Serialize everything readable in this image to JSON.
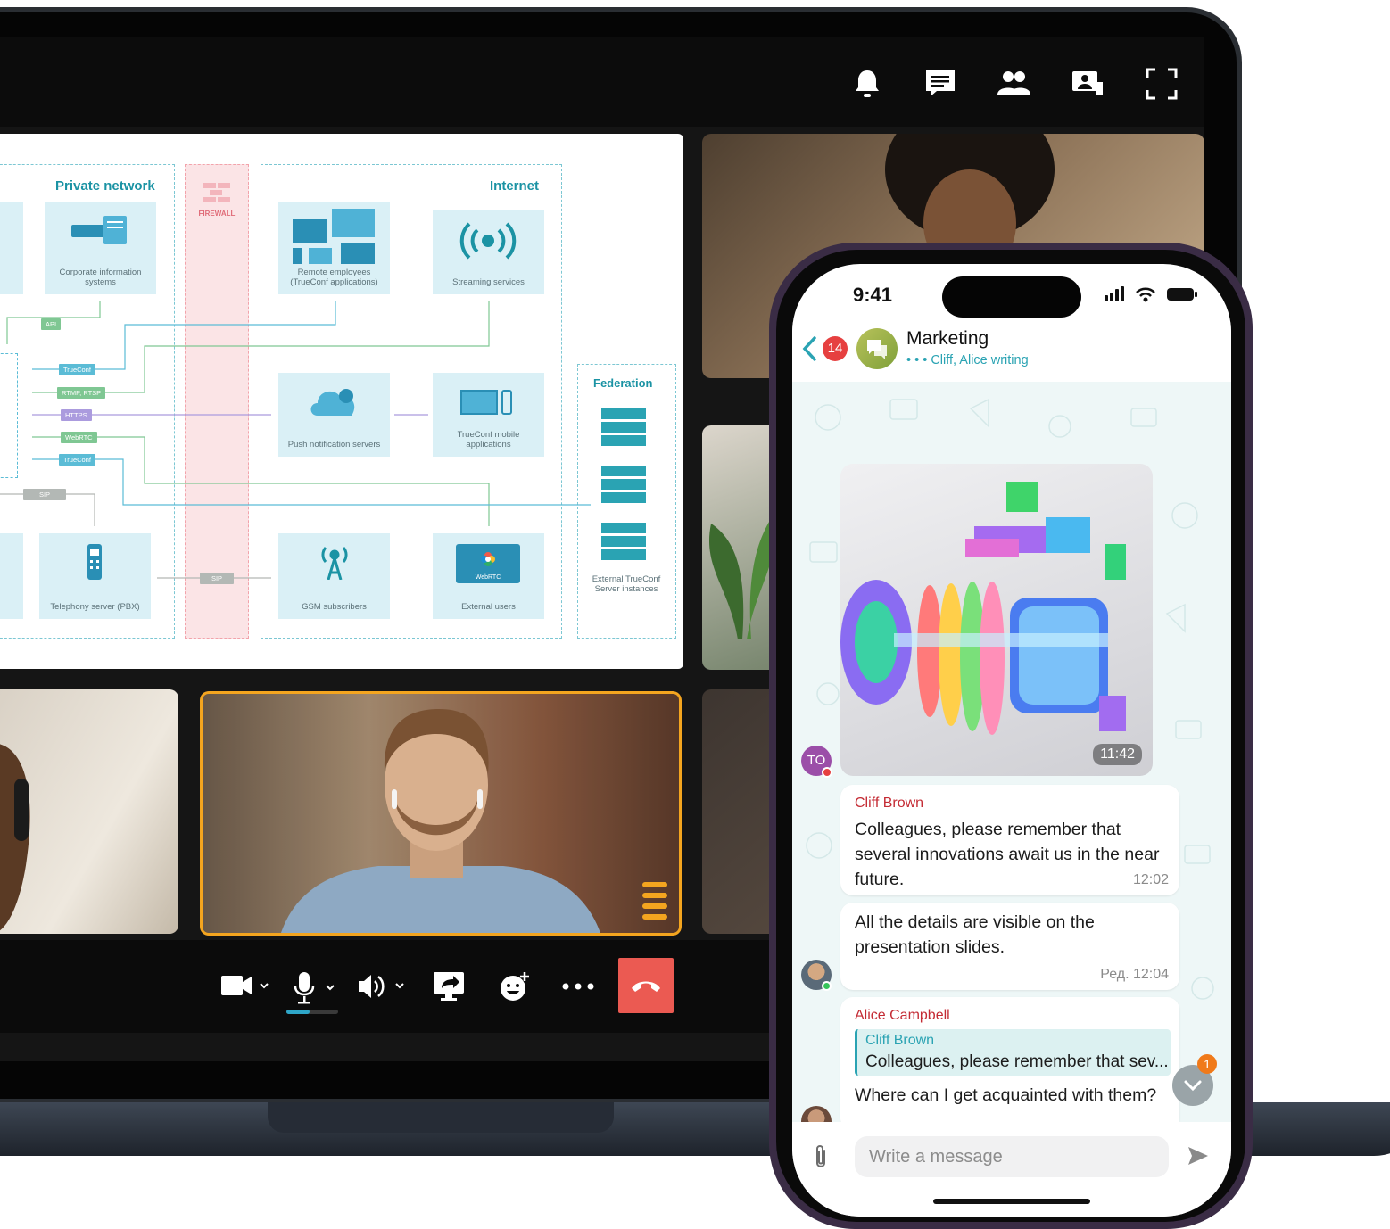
{
  "diagram": {
    "zones": {
      "private_network": "Private network",
      "firewall": "FIREWALL",
      "internet": "Internet",
      "federation": "Federation"
    },
    "boxes": {
      "corporate": "Corporate information systems",
      "remote": "Remote employees (TrueConf applications)",
      "streaming": "Streaming services",
      "push": "Push notification servers",
      "mobile": "TrueConf mobile applications",
      "pbx": "Telephony server (PBX)",
      "gsm": "GSM subscribers",
      "external_users": "External users",
      "external_servers": "External TrueConf Server instances"
    },
    "webrtc_badge": "WebRTC",
    "tags": {
      "api": "API",
      "trueconf_1": "TrueConf",
      "rtmp": "RTMP, RTSP",
      "https": "HTTPS",
      "webrtc": "WebRTC",
      "trueconf_2": "TrueConf",
      "sip_1": "SIP",
      "sip_2": "SIP"
    }
  },
  "conference": {
    "top_icons": [
      "bell-icon",
      "chat-icon",
      "participants-icon",
      "layout-icon",
      "fullscreen-icon"
    ],
    "accent_color": "#f4a51f",
    "hangup_color": "#eb5a52",
    "mic_level": 0.45
  },
  "phone": {
    "status_time": "9:41",
    "chat": {
      "unread_count": "14",
      "title": "Marketing",
      "typing": "Cliff, Alice writing",
      "image_time": "11:42",
      "sender_avatar_initials": "TO",
      "messages": [
        {
          "sender": "Cliff Brown",
          "text": "Colleagues, please remember that several innovations await us in the near future.",
          "time": "12:02"
        },
        {
          "text": "All the details are visible on the presentation slides.",
          "time": "Ред. 12:04"
        },
        {
          "sender": "Alice Campbell",
          "quote_author": "Cliff Brown",
          "quote_text": "Colleagues, please remember that sev...",
          "text": "Where can I get acquainted with them?"
        }
      ],
      "scroll_badge": "1",
      "placeholder": "Write a message"
    }
  }
}
